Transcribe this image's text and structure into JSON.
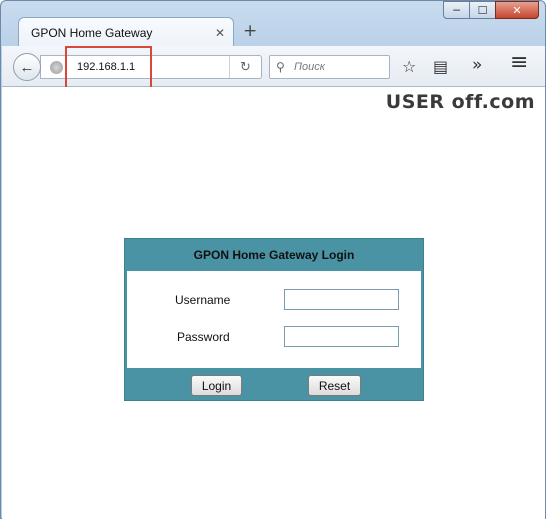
{
  "window": {
    "minimize": "─",
    "maximize": "☐",
    "close": "✕"
  },
  "tab": {
    "title": "GPON Home Gateway",
    "close": "✕",
    "new_tab": "+"
  },
  "toolbar": {
    "back": "←",
    "url": "192.168.1.1",
    "reload": "↻",
    "search_placeholder": "Поиск",
    "search_icon": "⚲",
    "bookmark_icon": "☆",
    "reader_icon": "▤",
    "overflow_icon": "»",
    "menu_icon": "≡"
  },
  "watermark": {
    "text": "USER off.com"
  },
  "login": {
    "title": "GPON Home Gateway Login",
    "username_label": "Username",
    "password_label": "Password",
    "username_value": "",
    "password_value": "",
    "login_button": "Login",
    "reset_button": "Reset"
  },
  "colors": {
    "accent": "#4a93a4",
    "highlight": "#d9463a"
  }
}
